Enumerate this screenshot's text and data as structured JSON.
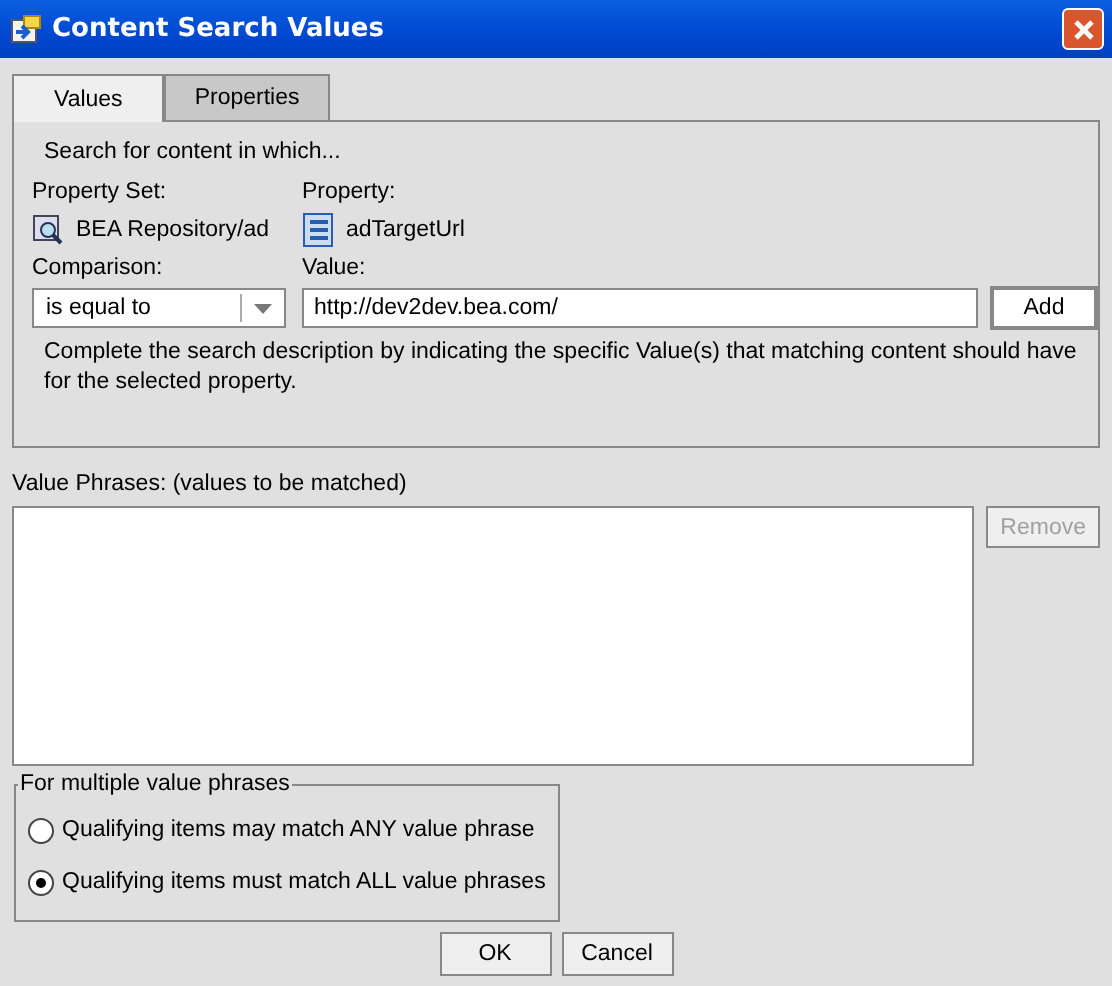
{
  "window": {
    "title": "Content Search Values"
  },
  "tabs": [
    {
      "label": "Values",
      "selected": true
    },
    {
      "label": "Properties",
      "selected": false
    }
  ],
  "values_tab": {
    "intro": "Search for content in which...",
    "property_set_label": "Property Set:",
    "property_set": "BEA Repository/ad",
    "property_label": "Property:",
    "property": "adTargetUrl",
    "comparison_label": "Comparison:",
    "comparison": "is equal to",
    "value_label": "Value:",
    "value": "http://dev2dev.bea.com/",
    "add_button": "Add",
    "help": "Complete the search description by indicating the specific Value(s) that matching content should have for the selected property."
  },
  "value_phrases": {
    "label": "Value Phrases:  (values to be matched)",
    "remove_button": {
      "label": "Remove",
      "disabled": true
    }
  },
  "multiple": {
    "title": "For multiple value phrases",
    "options": [
      {
        "label": "Qualifying items may match ANY value phrase",
        "selected": false
      },
      {
        "label": "Qualifying items must match ALL value phrases",
        "selected": true
      }
    ]
  },
  "buttons": [
    "OK",
    "Cancel"
  ]
}
